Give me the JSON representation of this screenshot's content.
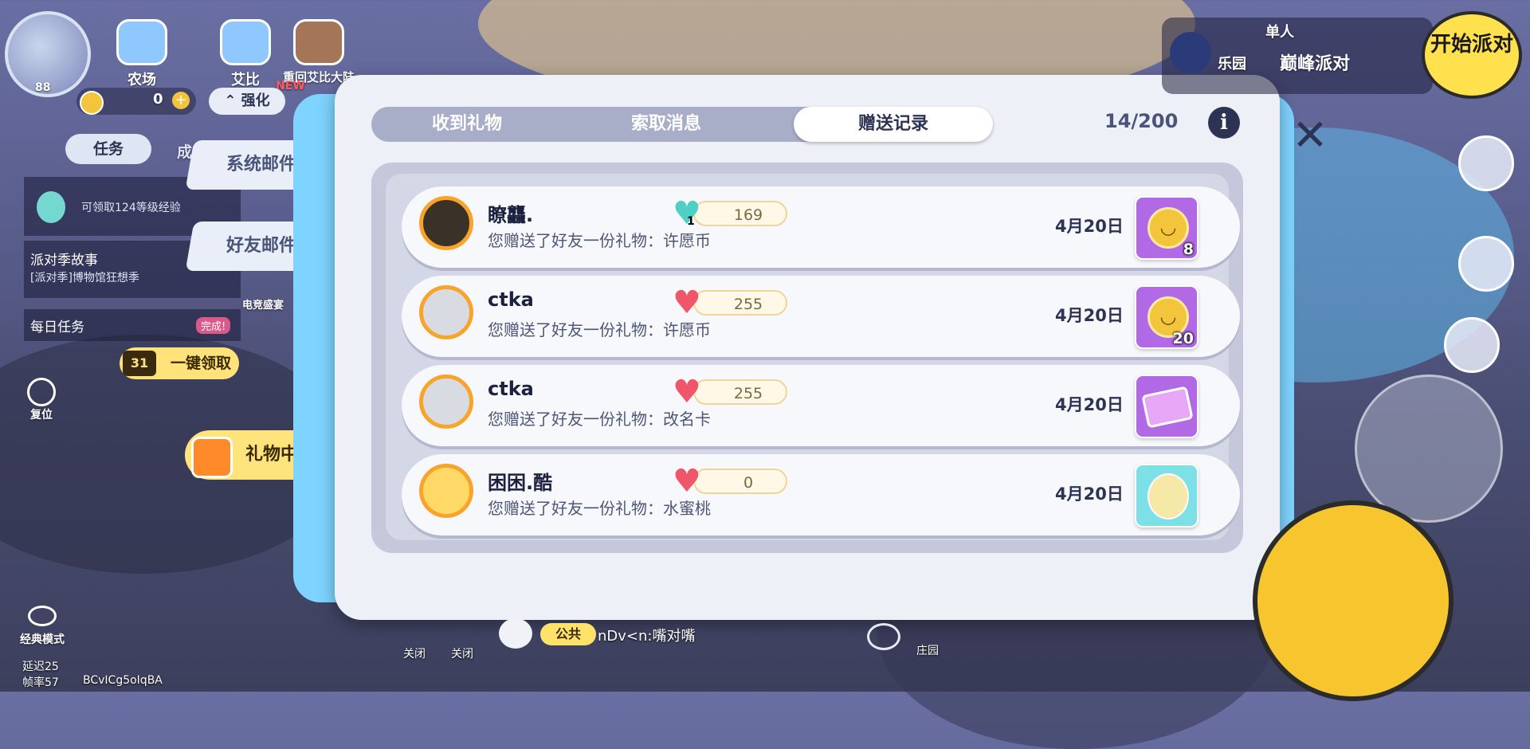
{
  "hud": {
    "level": "88",
    "buttons": [
      "农场",
      "艾比",
      "重回艾比大陆"
    ],
    "new_badge": "NEW",
    "coins": "0",
    "strengthen": "强化",
    "task_tab": "任务",
    "task_tab_second": "成",
    "quests": [
      {
        "title": "可领取124等级经验",
        "sub": ""
      },
      {
        "title": "派对季故事",
        "sub": "[派对季]博物馆狂想季"
      },
      {
        "title": "每日任务",
        "sub": "完成!"
      }
    ],
    "quest_extra": "电竞盛宴",
    "claim_count": "31",
    "claim_all": "一键领取",
    "reset": "复位",
    "classic_mode": "经典模式",
    "latency": "延迟25",
    "fps": "帧率57",
    "user_code": "BCvICg5oIqBA"
  },
  "side_tabs": [
    "系统邮件",
    "好友邮件"
  ],
  "gift_center": "礼物中心",
  "modal": {
    "tabs": [
      "收到礼物",
      "索取消息",
      "赠送记录"
    ],
    "active_tab": 2,
    "counter": "14/200",
    "info": "i",
    "rows": [
      {
        "name": "瞭龘.",
        "heart_value": "169",
        "heart_badge": "1",
        "heart_style": "teal",
        "desc": "您赠送了好友一份礼物：许愿币",
        "date": "4月20日",
        "item": "coin",
        "count": "8"
      },
      {
        "name": "ctka",
        "heart_value": "255",
        "heart_badge": "",
        "heart_style": "red",
        "desc": "您赠送了好友一份礼物：许愿币",
        "date": "4月20日",
        "item": "coin",
        "count": "20"
      },
      {
        "name": "ctka",
        "heart_value": "255",
        "heart_badge": "",
        "heart_style": "red",
        "desc": "您赠送了好友一份礼物：改名卡",
        "date": "4月20日",
        "item": "card",
        "count": ""
      },
      {
        "name": "困困.酷",
        "heart_value": "0",
        "heart_badge": "",
        "heart_style": "red",
        "desc": "您赠送了好友一份礼物：水蜜桃",
        "date": "4月20日",
        "item": "peach",
        "count": ""
      }
    ],
    "close": "✕"
  },
  "right_hud": {
    "mode_label": "单人",
    "party_name": "巅峰派对",
    "manor_short": "乐园",
    "start_party": "开始派对",
    "top_icons": [
      "热销",
      "手册",
      "宝盒",
      "商城",
      "好友"
    ]
  },
  "bottom": {
    "close_a": "关闭",
    "close_b": "关闭",
    "public": "公共",
    "message": "nDv<n:嘴对嘴",
    "manor": "庄园"
  }
}
